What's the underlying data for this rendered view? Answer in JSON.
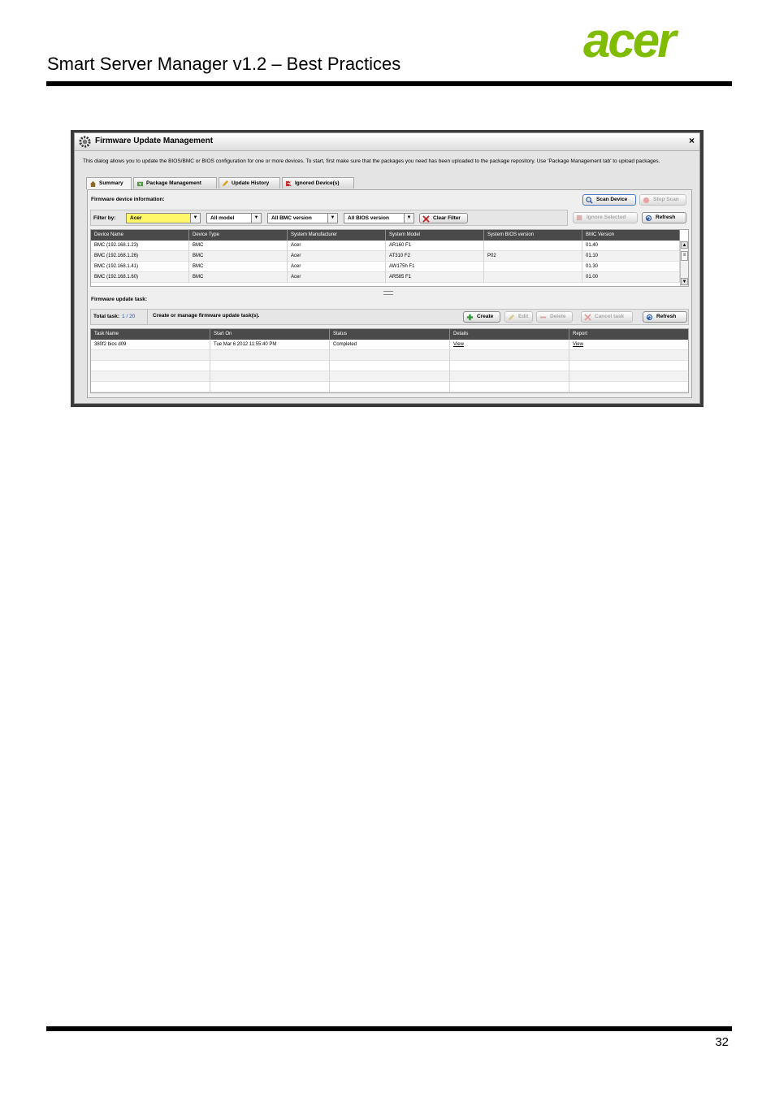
{
  "document": {
    "title": "Smart Server Manager v1.2 – Best Practices",
    "logo_text": "acer",
    "page_number": "32",
    "colors": {
      "logo_green": "#80bc00",
      "rule": "#000000"
    }
  },
  "dialog": {
    "title": "Firmware Update Management",
    "title_icon": "gear-icon",
    "close_label": "×",
    "description": "This dialog allows you to update the BIOS/BMC or BIOS configuration for one or more devices.  To start, first make sure that the packages you need has been uploaded to the package repository. Use 'Package Management tab' to upload packages.",
    "tabs": [
      {
        "label": "Summary",
        "icon": "home-icon"
      },
      {
        "label": "Package Management",
        "icon": "package-icon"
      },
      {
        "label": "Update History",
        "icon": "pencil-icon"
      },
      {
        "label": "Ignored Device(s)",
        "icon": "ignore-icon"
      }
    ],
    "device_section": {
      "label": "Firmware device information:",
      "scan_button": "Scan Device",
      "stop_scan_button": "Stop Scan",
      "ignore_selected_button": "Ignore Selected",
      "refresh_button": "Refresh",
      "filter_label": "Filter by:",
      "filters": {
        "manufacturer": "Acer",
        "model": "All model",
        "bmc_version": "All BMC version",
        "bios_version": "All BIOS version"
      },
      "clear_filter_button": "Clear Filter",
      "columns": [
        "Device Name",
        "Device Type",
        "System Manufacturer",
        "System Model",
        "System BIOS version",
        "BMC Version"
      ],
      "rows": [
        [
          "BMC (192.168.1.23)",
          "BMC",
          "Acer",
          "AR160 F1",
          "",
          "01.40"
        ],
        [
          "BMC (192.168.1.26)",
          "BMC",
          "Acer",
          "AT310 F2",
          "P02",
          "01.10"
        ],
        [
          "BMC (192.168.1.41)",
          "BMC",
          "Acer",
          "AW175h F1",
          "",
          "01.30"
        ],
        [
          "BMC (192.168.1.60)",
          "BMC",
          "Acer",
          "AR585 F1",
          "",
          "01.00"
        ]
      ]
    },
    "task_section": {
      "label": "Firmware update task:",
      "total_label": "Total task:",
      "total_count": "1 / 20",
      "hint": "Create or manage firmware update task(s).",
      "create_button": "Create",
      "edit_button": "Edit",
      "delete_button": "Delete",
      "cancel_task_button": "Cancel task",
      "refresh_button": "Refresh",
      "columns": [
        "Task Name",
        "Start On",
        "Status",
        "Details",
        "Report"
      ],
      "rows": [
        [
          "380f2 bios d09",
          "Tue Mar 6 2012 11:55:40 PM",
          "Completed",
          "View",
          "View"
        ]
      ]
    }
  }
}
